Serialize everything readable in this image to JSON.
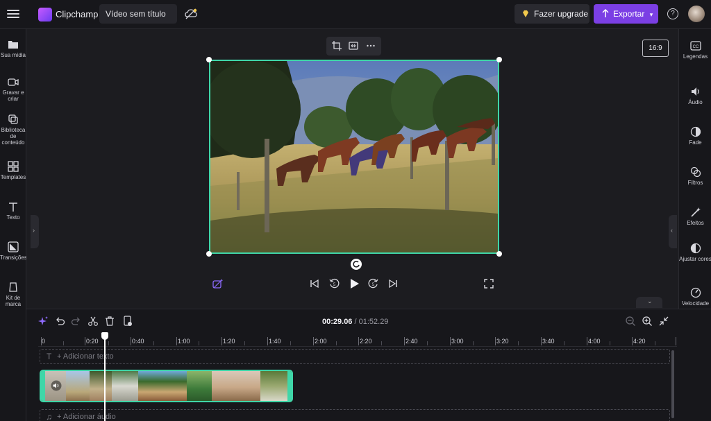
{
  "topbar": {
    "brand": "Clipchamp",
    "project_title": "Vídeo sem título",
    "upgrade_label": "Fazer upgrade",
    "export_label": "Exportar",
    "accent_color": "#7b3fe4"
  },
  "left_nav": [
    {
      "label": "Sua mídia",
      "icon": "folder-icon"
    },
    {
      "label": "Gravar e criar",
      "icon": "record-icon"
    },
    {
      "label": "Biblioteca de conteúdo",
      "icon": "library-icon"
    },
    {
      "label": "Templates",
      "icon": "templates-icon"
    },
    {
      "label": "Texto",
      "icon": "text-icon"
    },
    {
      "label": "Transições",
      "icon": "transitions-icon"
    },
    {
      "label": "Kit de marca",
      "icon": "brand-kit-icon"
    }
  ],
  "right_nav": [
    {
      "label": "Legendas",
      "icon": "captions-icon"
    },
    {
      "label": "Áudio",
      "icon": "speaker-icon"
    },
    {
      "label": "Fade",
      "icon": "fade-icon"
    },
    {
      "label": "Filtros",
      "icon": "filters-icon"
    },
    {
      "label": "Efeitos",
      "icon": "magic-wand-icon"
    },
    {
      "label": "Ajustar cores",
      "icon": "contrast-icon"
    },
    {
      "label": "Velocidade",
      "icon": "speedometer-icon"
    }
  ],
  "stage": {
    "aspect_ratio": "16:9"
  },
  "timeline": {
    "current_time": "00:29.06",
    "separator": " / ",
    "total_time": "01:52.29",
    "ruler_labels": [
      "0",
      "0:20",
      "0:40",
      "1:00",
      "1:20",
      "1:40",
      "2:00",
      "2:20",
      "2:40",
      "3:00",
      "3:20",
      "3:40",
      "4:00",
      "4:20"
    ],
    "add_text_label": "+ Adicionar texto",
    "add_audio_label": "+ Adicionar áudio",
    "playhead_time": "00:29.06"
  }
}
